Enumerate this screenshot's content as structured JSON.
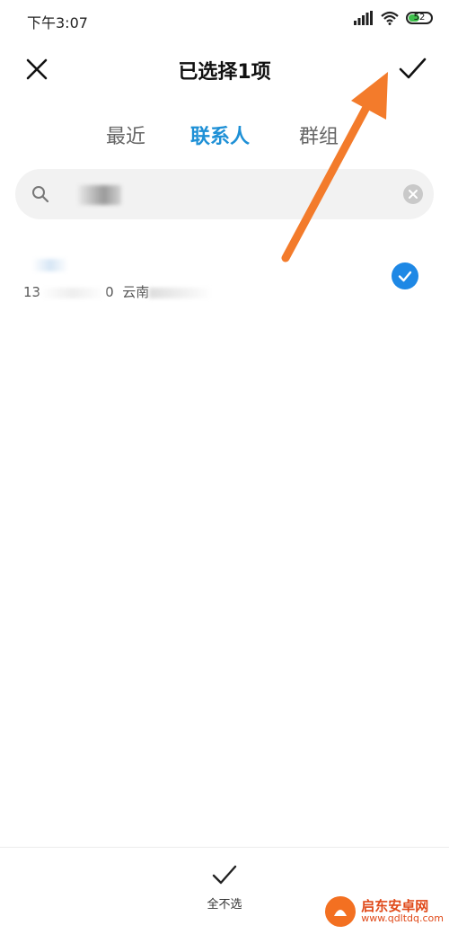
{
  "status_bar": {
    "time": "下午3:07",
    "battery_level": "52",
    "battery_fraction": 0.52,
    "icons": [
      "signal-icon",
      "wifi-icon",
      "battery-icon"
    ]
  },
  "header": {
    "title": "已选择1项",
    "close_icon": "close-icon",
    "confirm_icon": "check-icon"
  },
  "tabs": [
    {
      "label": "最近",
      "active": false
    },
    {
      "label": "联系人",
      "active": true
    },
    {
      "label": "群组",
      "active": false
    }
  ],
  "search": {
    "icon": "search-icon",
    "value": "",
    "clear_icon": "clear-icon"
  },
  "contacts": [
    {
      "phone_prefix": "13",
      "phone_suffix": "0",
      "location": "云南",
      "selected": true
    }
  ],
  "bottom_bar": {
    "deselect_label": "全不选",
    "deselect_icon": "check-icon"
  },
  "watermark": {
    "title": "启东安卓网",
    "url": "www.qdltdq.com"
  },
  "colors": {
    "accent": "#1e90d6",
    "check_circle": "#1e88e5",
    "arrow": "#f37b2b",
    "battery": "#3ec04b",
    "watermark": "#e04a1a"
  }
}
